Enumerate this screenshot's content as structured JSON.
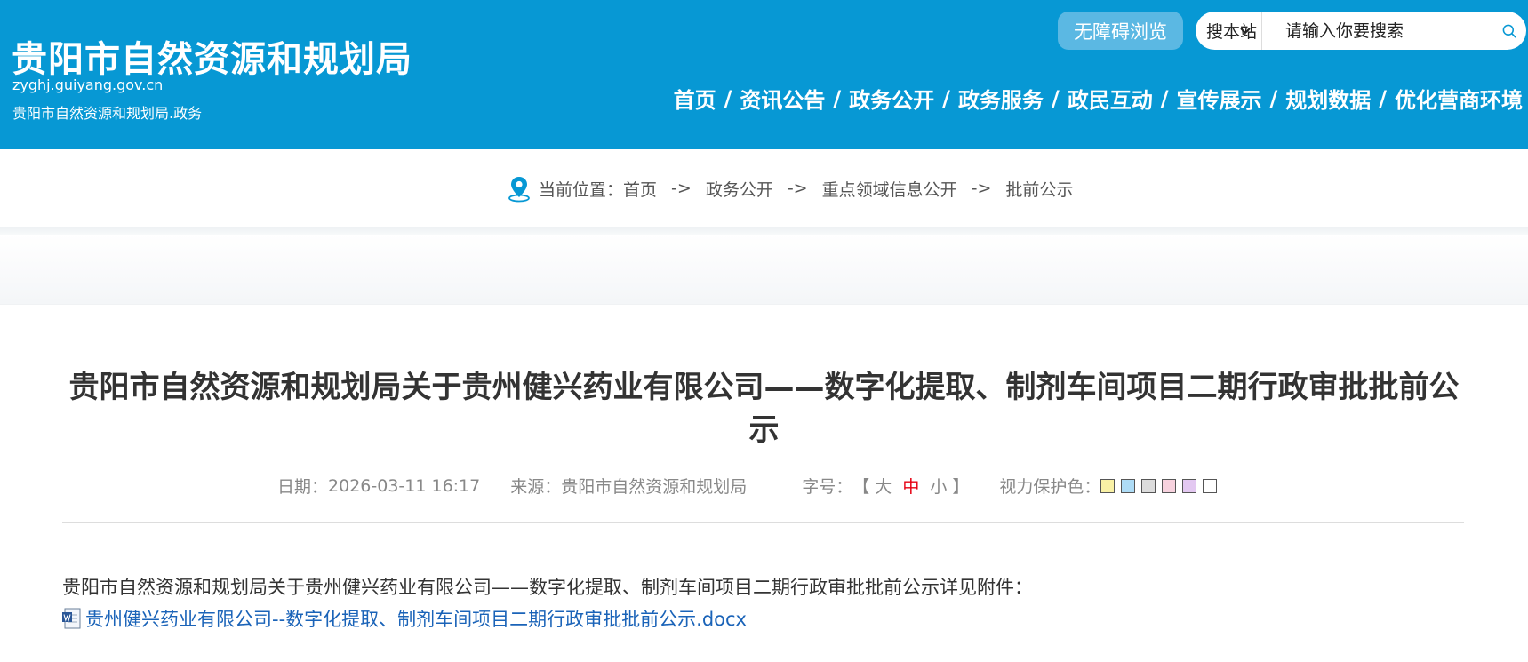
{
  "header": {
    "site_title": "贵阳市自然资源和规划局",
    "site_domain": "zyghj.guiyang.gov.cn",
    "site_subtitle": "贵阳市自然资源和规划局.政务",
    "accessibility_label": "无障碍浏览",
    "search": {
      "scope_selected": "搜本站",
      "placeholder": "请输入你要搜索"
    },
    "nav": [
      "首页",
      "资讯公告",
      "政务公开",
      "政务服务",
      "政民互动",
      "宣传展示",
      "规划数据",
      "优化营商环境"
    ],
    "nav_separator": "/"
  },
  "breadcrumb": {
    "prefix": "当前位置：",
    "items": [
      "首页",
      "政务公开",
      "重点领域信息公开",
      "批前公示"
    ],
    "arrow": "->"
  },
  "article": {
    "title": "贵阳市自然资源和规划局关于贵州健兴药业有限公司——数字化提取、制剂车间项目二期行政审批批前公示",
    "date_label": "日期：",
    "date_value": "2026-03-11 16:17",
    "source_label": "来源：",
    "source_value": "贵阳市自然资源和规划局",
    "font_size_label": "字号：",
    "font_size_open": "【",
    "font_sizes": [
      "大",
      "中",
      "小"
    ],
    "font_size_active": "中",
    "font_size_close": "】",
    "eye_care_label": "视力保护色：",
    "eye_care_colors": [
      "#f9f1a5",
      "#aedcf6",
      "#dcdcdc",
      "#f7d2de",
      "#e3c8f1",
      "#ffffff"
    ],
    "body": "贵阳市自然资源和规划局关于贵州健兴药业有限公司——数字化提取、制剂车间项目二期行政审批批前公示详见附件：",
    "attachment": "贵州健兴药业有限公司--数字化提取、制剂车间项目二期行政审批批前公示.docx"
  },
  "colors": {
    "header_bg": "#0798d4",
    "active_font_size": "#e60012",
    "link": "#1a63b8"
  }
}
